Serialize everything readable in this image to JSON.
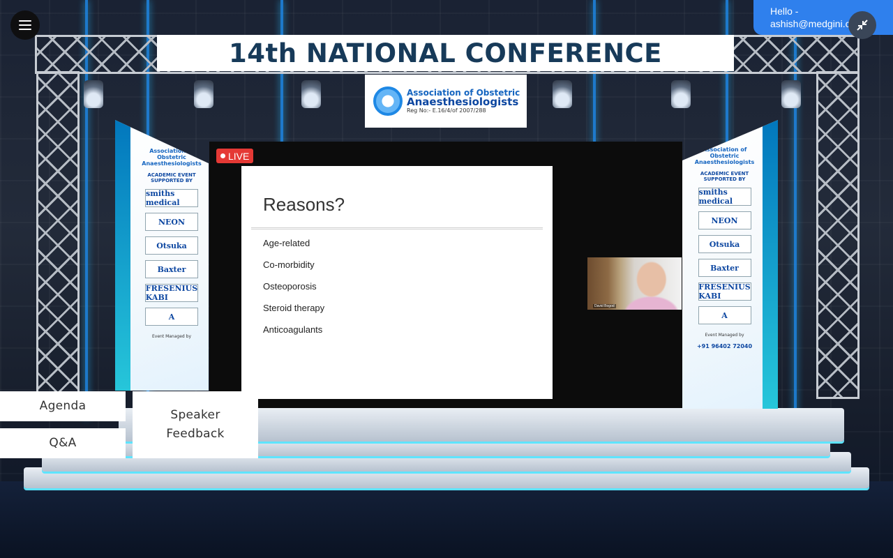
{
  "conference": {
    "title": "14th NATIONAL CONFERENCE",
    "org_line1": "Association of Obstetric",
    "org_line2": "Anaesthesiologists",
    "org_reg": "Reg No:- E.16/4/of 2007/288"
  },
  "side_boards": {
    "org": "Association of Obstetric Anaesthesiologists",
    "supported_by": "ACADEMIC EVENT SUPPORTED BY",
    "sponsors": [
      "smiths medical",
      "NEON",
      "Otsuka",
      "Baxter",
      "FRESENIUS KABI",
      "A"
    ],
    "managed_by": "Event Managed by",
    "phone": "+91 96402 72040"
  },
  "stream": {
    "live_label": "LIVE",
    "slide_title": "Reasons?",
    "slide_items": [
      "Age-related",
      "Co-morbidity",
      "Osteoporosis",
      "Steroid therapy",
      "Anticoagulants"
    ],
    "speaker_name": "David Bogod"
  },
  "user": {
    "greeting": "Hello -",
    "email": "ashish@medgini.com"
  },
  "nav": {
    "agenda": "Agenda",
    "qa": "Q&A",
    "feedback_line1": "Speaker",
    "feedback_line2": "Feedback"
  },
  "icons": {
    "menu": "hamburger-menu-icon",
    "collapse": "collapse-arrows-icon"
  },
  "colors": {
    "accent": "#2f80ed",
    "live": "#e53935",
    "banner_text": "#173a59"
  }
}
